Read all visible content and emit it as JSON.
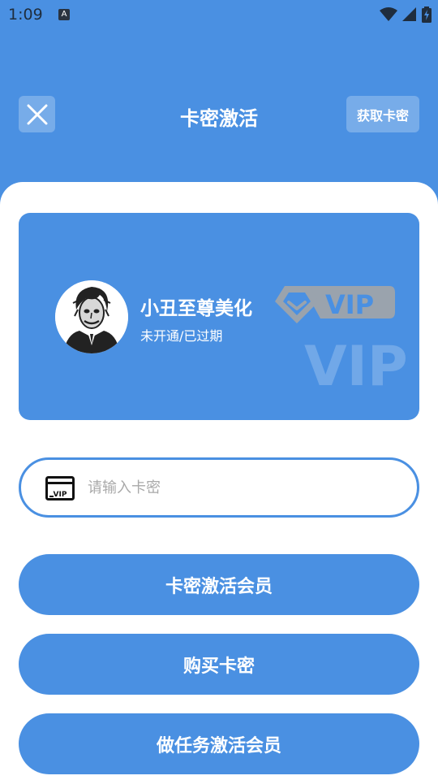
{
  "status_bar": {
    "time": "1:09",
    "notification_icon_letter": "A",
    "icons": [
      "wifi-icon",
      "cell-signal-icon",
      "battery-charging-icon"
    ]
  },
  "header": {
    "close_icon": "close-icon",
    "title": "卡密激活",
    "get_card_label": "获取卡密"
  },
  "vip_card": {
    "user_name": "小丑至尊美化",
    "status": "未开通/已过期",
    "badge_text": "VIP",
    "watermark_text": "VIP"
  },
  "code_input": {
    "icon": "vip-card-icon",
    "icon_text": "VIP",
    "placeholder": "请输入卡密",
    "value": ""
  },
  "buttons": {
    "activate": "卡密激活会员",
    "buy": "购买卡密",
    "task_activate": "做任务激活会员"
  },
  "colors": {
    "primary": "#4a90e2",
    "sheet": "#ffffff",
    "badge_gray": "#9aa3ad"
  }
}
